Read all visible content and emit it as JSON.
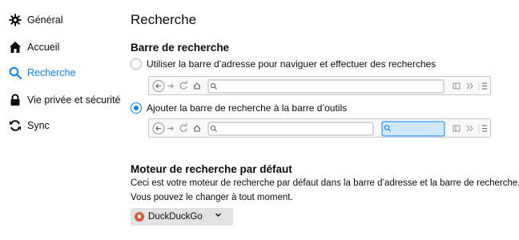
{
  "sidebar": {
    "items": [
      {
        "label": "Général",
        "icon": "gear-icon",
        "active": false
      },
      {
        "label": "Accueil",
        "icon": "home-icon",
        "active": false
      },
      {
        "label": "Recherche",
        "icon": "search-icon",
        "active": true
      },
      {
        "label": "Vie privée et sécurité",
        "icon": "lock-icon",
        "active": false
      },
      {
        "label": "Sync",
        "icon": "sync-icon",
        "active": false
      }
    ]
  },
  "main": {
    "title": "Recherche",
    "search_bar": {
      "heading": "Barre de recherche",
      "options": [
        {
          "label": "Utiliser la barre d’adresse pour naviguer et effectuer des recherches",
          "checked": false
        },
        {
          "label": "Ajouter la barre de recherche à la barre d’outils",
          "checked": true
        }
      ]
    },
    "default_engine": {
      "heading": "Moteur de recherche par défaut",
      "description": "Ceci est votre moteur de recherche par défaut dans la barre d’adresse et la barre de recherche.",
      "note": "Vous pouvez le changer à tout moment.",
      "selected": "DuckDuckGo"
    }
  },
  "colors": {
    "accent": "#0a84ff",
    "duckduckgo": "#de5833",
    "highlight": "#cfe6ff"
  }
}
